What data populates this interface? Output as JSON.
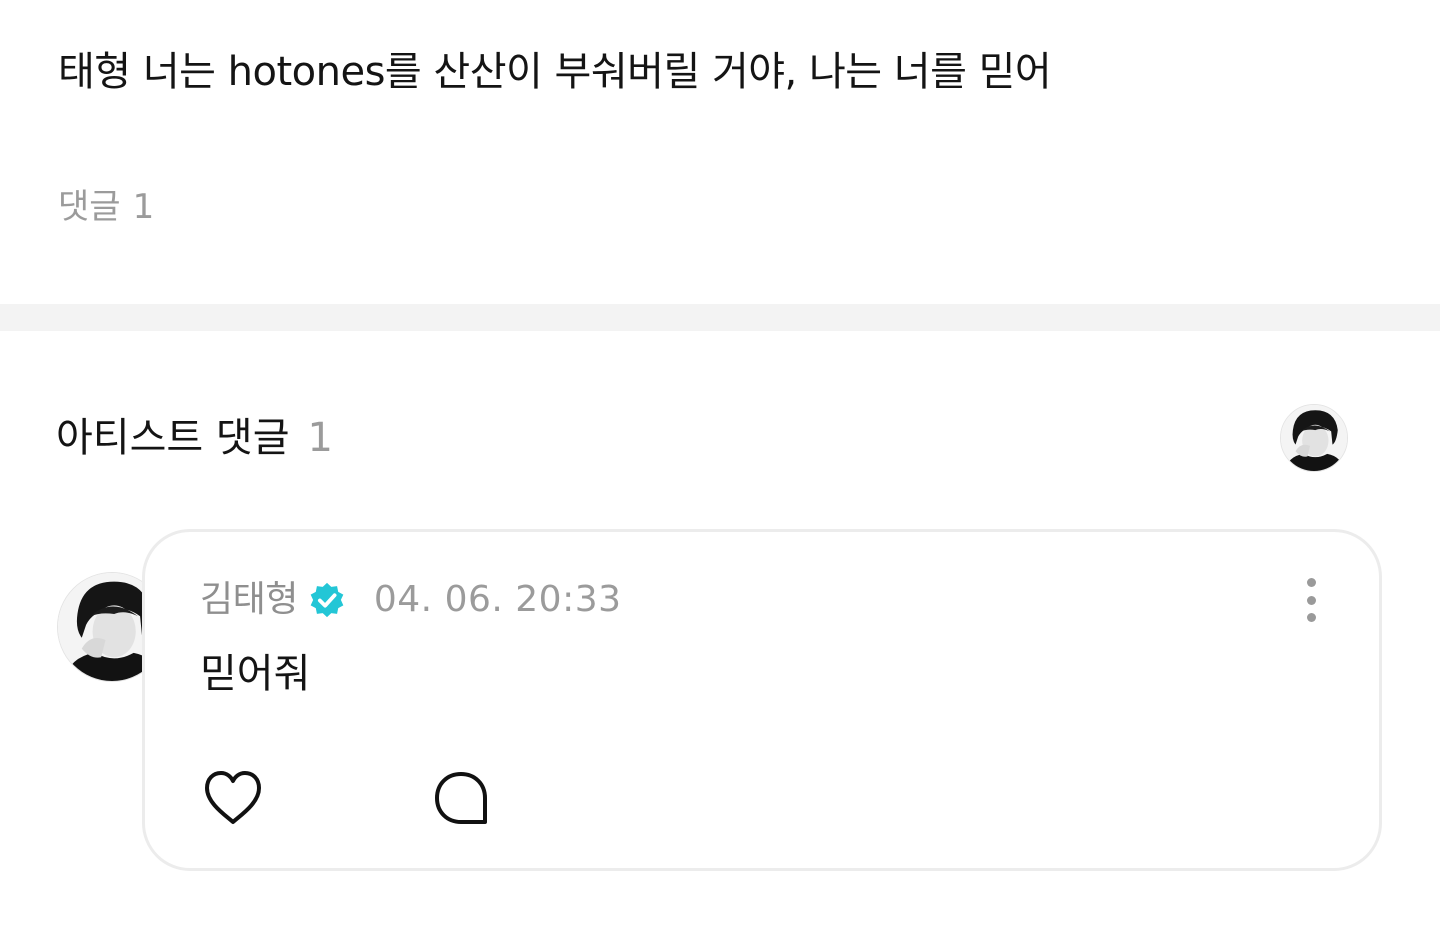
{
  "post": {
    "text": "태형 너는 hotones를 산산이 부숴버릴 거야, 나는 너를 믿어",
    "comment_label": "댓글",
    "comment_count": "1"
  },
  "artist_comments": {
    "title": "아티스트 댓글",
    "count": "1"
  },
  "comment": {
    "author": "김태형",
    "timestamp": "04. 06. 20:33",
    "body": "믿어줘"
  },
  "icons": {
    "verified": "verified-badge-icon",
    "more": "more-vertical-icon",
    "like": "heart-icon",
    "reply": "speech-bubble-icon"
  },
  "colors": {
    "verified_badge": "#23c6d6",
    "muted_text": "#9b9b9b",
    "divider": "#f3f3f3",
    "card_border": "#ececec"
  }
}
